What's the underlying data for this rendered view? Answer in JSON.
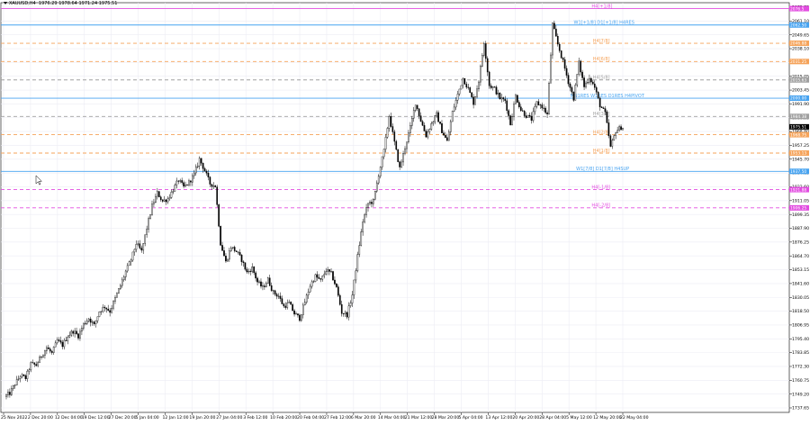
{
  "header": {
    "symbol": "XAUUSD,H4",
    "ohlc": "1976.29 1978.64 1971.24 1975.51"
  },
  "colors": {
    "background": "#ffffff",
    "grid": "#ececf4",
    "candle": "#000000",
    "blue_level": "#47a3f0",
    "orange_level": "#f5a35a",
    "gray_level": "#a0a0a0",
    "magenta_level": "#e24ce0"
  },
  "chart_data": {
    "type": "candlestick",
    "title": "XAUUSD,H4",
    "grid": true,
    "ylim": [
      1737.0,
      2080.0
    ],
    "y_ticks": [
      "2072.75",
      "2061.10",
      "2049.65",
      "2038.10",
      "2026.55",
      "2015.05",
      "2003.45",
      "1991.90",
      "1980.35",
      "1968.80",
      "1957.25",
      "1945.70",
      "1934.15",
      "1922.60",
      "1911.05",
      "1899.35",
      "1887.90",
      "1876.25",
      "1864.70",
      "1853.15",
      "1841.60",
      "1830.05",
      "1818.50",
      "1806.95",
      "1795.40",
      "1783.85",
      "1772.30",
      "1760.75",
      "1749.20",
      "1737.65"
    ],
    "x_ticks": [
      "25 Nov 2022",
      "2 Dec 20:00",
      "12 Dec 04:00",
      "19 Dec 12:00",
      "27 Dec 20:00",
      "5 Jan 04:00",
      "12 Jan 12:00",
      "19 Jan 20:00",
      "27 Jan 04:00",
      "3 Feb 12:00",
      "10 Feb 20:00",
      "20 Feb 04:00",
      "27 Feb 12:00",
      "6 Mar 20:00",
      "14 Mar 04:00",
      "21 Mar 12:00",
      "28 Mar 20:00",
      "5 Apr 04:00",
      "13 Apr 12:00",
      "20 Apr 20:00",
      "28 Apr 04:00",
      "5 May 12:00",
      "12 May 20:00",
      "22 May 04:00"
    ],
    "price_path": [
      [
        0,
        1745
      ],
      [
        3,
        1748
      ],
      [
        6,
        1756
      ],
      [
        9,
        1763
      ],
      [
        12,
        1761
      ],
      [
        15,
        1773
      ],
      [
        18,
        1772
      ],
      [
        21,
        1780
      ],
      [
        24,
        1787
      ],
      [
        27,
        1782
      ],
      [
        30,
        1793
      ],
      [
        33,
        1789
      ],
      [
        36,
        1797
      ],
      [
        39,
        1801
      ],
      [
        42,
        1797
      ],
      [
        45,
        1807
      ],
      [
        48,
        1812
      ],
      [
        51,
        1806
      ],
      [
        54,
        1818
      ],
      [
        57,
        1822
      ],
      [
        60,
        1818
      ],
      [
        63,
        1829
      ],
      [
        66,
        1840
      ],
      [
        69,
        1852
      ],
      [
        72,
        1862
      ],
      [
        75,
        1876
      ],
      [
        78,
        1869
      ],
      [
        81,
        1889
      ],
      [
        84,
        1908
      ],
      [
        87,
        1919
      ],
      [
        90,
        1912
      ],
      [
        93,
        1914
      ],
      [
        96,
        1922
      ],
      [
        99,
        1930
      ],
      [
        102,
        1924
      ],
      [
        105,
        1928
      ],
      [
        108,
        1935
      ],
      [
        111,
        1948
      ],
      [
        114,
        1938
      ],
      [
        117,
        1927
      ],
      [
        120,
        1925
      ],
      [
        123,
        1876
      ],
      [
        126,
        1860
      ],
      [
        129,
        1873
      ],
      [
        132,
        1869
      ],
      [
        135,
        1862
      ],
      [
        138,
        1851
      ],
      [
        141,
        1855
      ],
      [
        144,
        1843
      ],
      [
        147,
        1838
      ],
      [
        150,
        1845
      ],
      [
        153,
        1834
      ],
      [
        156,
        1831
      ],
      [
        159,
        1822
      ],
      [
        162,
        1825
      ],
      [
        165,
        1816
      ],
      [
        168,
        1812
      ],
      [
        171,
        1826
      ],
      [
        174,
        1840
      ],
      [
        177,
        1848
      ],
      [
        180,
        1844
      ],
      [
        183,
        1853
      ],
      [
        186,
        1850
      ],
      [
        189,
        1838
      ],
      [
        192,
        1817
      ],
      [
        195,
        1815
      ],
      [
        198,
        1832
      ],
      [
        201,
        1865
      ],
      [
        204,
        1895
      ],
      [
        207,
        1910
      ],
      [
        210,
        1912
      ],
      [
        213,
        1935
      ],
      [
        216,
        1955
      ],
      [
        219,
        1985
      ],
      [
        222,
        1962
      ],
      [
        225,
        1940
      ],
      [
        228,
        1958
      ],
      [
        231,
        1975
      ],
      [
        234,
        1996
      ],
      [
        237,
        1981
      ],
      [
        240,
        1968
      ],
      [
        243,
        1978
      ],
      [
        246,
        1986
      ],
      [
        249,
        1972
      ],
      [
        252,
        1963
      ],
      [
        255,
        1988
      ],
      [
        258,
        2003
      ],
      [
        261,
        2017
      ],
      [
        264,
        2008
      ],
      [
        267,
        1996
      ],
      [
        270,
        2015
      ],
      [
        273,
        2048
      ],
      [
        276,
        2011
      ],
      [
        279,
        2008
      ],
      [
        282,
        2000
      ],
      [
        285,
        1998
      ],
      [
        288,
        1978
      ],
      [
        291,
        2002
      ],
      [
        294,
        1990
      ],
      [
        297,
        1985
      ],
      [
        300,
        1982
      ],
      [
        303,
        1996
      ],
      [
        306,
        1993
      ],
      [
        309,
        1986
      ],
      [
        312,
        2063
      ],
      [
        315,
        2046
      ],
      [
        318,
        2031
      ],
      [
        321,
        2014
      ],
      [
        324,
        2000
      ],
      [
        327,
        2030
      ],
      [
        330,
        2010
      ],
      [
        333,
        2018
      ],
      [
        336,
        2009
      ],
      [
        339,
        1994
      ],
      [
        342,
        1987
      ],
      [
        345,
        1958
      ],
      [
        348,
        1972
      ],
      [
        351,
        1975
      ]
    ],
    "levels": [
      {
        "label": "H4[+1/8]",
        "price": 2076.5,
        "color": "magenta",
        "style": "solid",
        "tag": "2076.5"
      },
      {
        "label": "W1[+1/8] D1[+1/8] H4RES",
        "price": 2062.5,
        "color": "blue",
        "style": "solid",
        "tag": "2062.50"
      },
      {
        "label": "H4[7/8]",
        "price": 2046.9,
        "color": "orange",
        "style": "dashed",
        "tag": "2046.88"
      },
      {
        "label": "H4[6/8]",
        "price": 2031.3,
        "color": "orange",
        "style": "dashed",
        "tag": "2031.25"
      },
      {
        "label": "H4[5/8]",
        "price": 2015.6,
        "color": "gray",
        "style": "dashed",
        "tag": "2015.63"
      },
      {
        "label": "MN1RES W1RES D1RES H4PIVOT",
        "price": 2000.0,
        "color": "blue",
        "style": "solid",
        "tag": "2000.00"
      },
      {
        "label": "H4[3/8]",
        "price": 1984.4,
        "color": "gray",
        "style": "dashed",
        "tag": "1984.38"
      },
      {
        "label": "H4[2/8]",
        "price": 1968.8,
        "color": "orange",
        "style": "dashed",
        "tag": "1968.75"
      },
      {
        "label": "H4[1/8]",
        "price": 1953.1,
        "color": "orange",
        "style": "dashed",
        "tag": "1953.13"
      },
      {
        "label": "W1[7/8] D1[7/8] H4SUP",
        "price": 1937.5,
        "color": "blue",
        "style": "solid",
        "tag": "1937.50"
      },
      {
        "label": "H4[-1/8]",
        "price": 1921.9,
        "color": "magenta",
        "style": "dashed",
        "tag": "1921.88"
      },
      {
        "label": "H4[-2/8]",
        "price": 1906.3,
        "color": "magenta",
        "style": "dashed",
        "tag": "1906.25"
      }
    ],
    "current_price": {
      "value": 1975.51,
      "tag": "1975.51"
    }
  }
}
